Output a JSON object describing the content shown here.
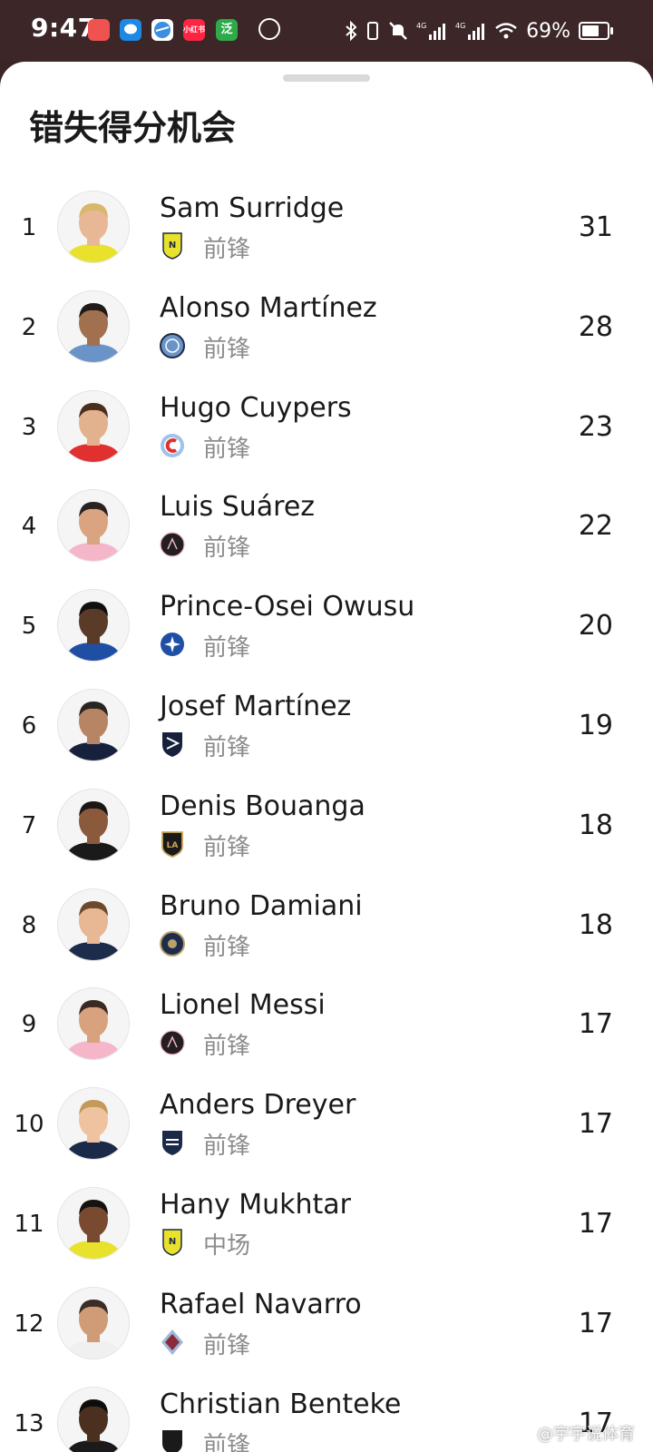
{
  "status_bar": {
    "time": "9:47",
    "battery_percent": "69%",
    "battery_level": 0.69,
    "icons": [
      "red-app-icon",
      "message-icon",
      "browser-icon",
      "xiaohongshu-icon",
      "green-app-icon",
      "speed-badge-icon",
      "bluetooth-icon",
      "vibrate-icon",
      "mute-icon",
      "signal-4g-icon",
      "signal-4g-icon",
      "wifi-icon"
    ],
    "app_labels": {
      "xhs": "小红书",
      "green": "泛"
    }
  },
  "sheet": {
    "title": "错失得分机会"
  },
  "players": [
    {
      "rank": "1",
      "name": "Sam Surridge",
      "position": "前锋",
      "value": "31",
      "club_crest": "nashville-crest-icon",
      "crest_color": "#e8e22c"
    },
    {
      "rank": "2",
      "name": "Alonso Martínez",
      "position": "前锋",
      "value": "28",
      "club_crest": "nycfc-crest-icon",
      "crest_color": "#6a93c8"
    },
    {
      "rank": "3",
      "name": "Hugo Cuypers",
      "position": "前锋",
      "value": "23",
      "club_crest": "chicago-fire-crest-icon",
      "crest_color": "#e0302f"
    },
    {
      "rank": "4",
      "name": "Luis Suárez",
      "position": "前锋",
      "value": "22",
      "club_crest": "inter-miami-crest-icon",
      "crest_color": "#231f20"
    },
    {
      "rank": "5",
      "name": "Prince-Osei Owusu",
      "position": "前锋",
      "value": "20",
      "club_crest": "cf-montreal-crest-icon",
      "crest_color": "#1f4fa5"
    },
    {
      "rank": "6",
      "name": "Josef Martínez",
      "position": "前锋",
      "value": "19",
      "club_crest": "san-jose-crest-icon",
      "crest_color": "#17213b"
    },
    {
      "rank": "7",
      "name": "Denis Bouanga",
      "position": "前锋",
      "value": "18",
      "club_crest": "lafc-crest-icon",
      "crest_color": "#1a1a1a"
    },
    {
      "rank": "8",
      "name": "Bruno Damiani",
      "position": "前锋",
      "value": "18",
      "club_crest": "philadelphia-crest-icon",
      "crest_color": "#1d2c4a"
    },
    {
      "rank": "9",
      "name": "Lionel Messi",
      "position": "前锋",
      "value": "17",
      "club_crest": "inter-miami-crest-icon",
      "crest_color": "#231f20"
    },
    {
      "rank": "10",
      "name": "Anders Dreyer",
      "position": "前锋",
      "value": "17",
      "club_crest": "san-diego-crest-icon",
      "crest_color": "#1a2a48"
    },
    {
      "rank": "11",
      "name": "Hany Mukhtar",
      "position": "中场",
      "value": "17",
      "club_crest": "nashville-crest-icon",
      "crest_color": "#e8e22c"
    },
    {
      "rank": "12",
      "name": "Rafael Navarro",
      "position": "前锋",
      "value": "17",
      "club_crest": "colorado-crest-icon",
      "crest_color": "#8a2b3a"
    },
    {
      "rank": "13",
      "name": "Christian Benteke",
      "position": "前锋",
      "value": "17",
      "club_crest": "dc-united-crest-icon",
      "crest_color": "#1a1a1a"
    }
  ],
  "watermark": "@宇宇说体育"
}
